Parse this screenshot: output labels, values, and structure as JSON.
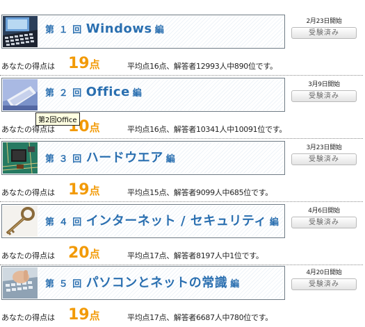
{
  "sessions": [
    {
      "prefix": "第",
      "num": "１",
      "kai": "回",
      "name": "Windows",
      "suffix": "編",
      "date": "2月23日開始",
      "button": "受験済み",
      "score_label": "あなたの得点は",
      "score": "19",
      "unit": "点",
      "stats": "平均点16点、解答者12993人中890位です。",
      "thumb": "keyboard"
    },
    {
      "prefix": "第",
      "num": "２",
      "kai": "回",
      "name": "Office",
      "suffix": "編",
      "date": "3月9日開始",
      "button": "受験済み",
      "score_label": "あなたの得点は",
      "score": "10",
      "unit": "点",
      "stats": "平均点16点、解答者10341人中10091位です。",
      "thumb": "office"
    },
    {
      "prefix": "第",
      "num": "３",
      "kai": "回",
      "name": "ハードウエア",
      "suffix": "編",
      "date": "3月23日開始",
      "button": "受験済み",
      "score_label": "あなたの得点は",
      "score": "19",
      "unit": "点",
      "stats": "平均点15点、解答者9099人中685位です。",
      "thumb": "circuit"
    },
    {
      "prefix": "第",
      "num": "４",
      "kai": "回",
      "name": "インターネット / セキュリティ",
      "suffix": "編",
      "date": "4月6日開始",
      "button": "受験済み",
      "score_label": "あなたの得点は",
      "score": "20",
      "unit": "点",
      "stats": "平均点17点、解答者8197人中1位です。",
      "thumb": "key"
    },
    {
      "prefix": "第",
      "num": "５",
      "kai": "回",
      "name": "パソコンとネットの常識",
      "suffix": "編",
      "date": "4月20日開始",
      "button": "受験済み",
      "score_label": "あなたの得点は",
      "score": "19",
      "unit": "点",
      "stats": "平均点17点、解答者6687人中780位です。",
      "thumb": "hand"
    }
  ],
  "tooltip": "第2回Office"
}
